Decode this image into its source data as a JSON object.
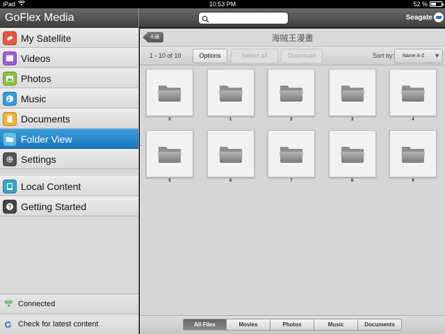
{
  "status_bar": {
    "device": "iPad",
    "time": "10:53 PM",
    "battery_text": "52 %",
    "battery_level": 0.52
  },
  "app": {
    "title": "GoFlex Media"
  },
  "sidebar": {
    "items": [
      {
        "label": "My Satellite",
        "icon": "satellite-icon",
        "color": "#e55a3e"
      },
      {
        "label": "Videos",
        "icon": "film-icon",
        "color": "#9b5fd6"
      },
      {
        "label": "Photos",
        "icon": "photo-icon",
        "color": "#8cc43b"
      },
      {
        "label": "Music",
        "icon": "music-icon",
        "color": "#2f9fe0"
      },
      {
        "label": "Documents",
        "icon": "document-icon",
        "color": "#f2b233"
      },
      {
        "label": "Folder View",
        "icon": "folder-icon",
        "color": "#5cc0e8",
        "selected": true
      },
      {
        "label": "Settings",
        "icon": "gear-icon",
        "color": "#555555"
      }
    ],
    "secondary_items": [
      {
        "label": "Local Content",
        "icon": "device-icon",
        "color": "#3aa4c8"
      },
      {
        "label": "Getting Started",
        "icon": "help-icon",
        "color": "#444444"
      }
    ],
    "footer": {
      "connected_label": "Connected",
      "refresh_label": "Check for latest content"
    }
  },
  "header": {
    "search_placeholder": "",
    "logo_text": "Seagate"
  },
  "folder": {
    "back_label": "卡通",
    "title": "海贼王漫畫",
    "count_label": "1 - 10 of 10",
    "options_label": "Options",
    "select_all_label": "Select all",
    "download_label": "Download",
    "sort_label": "Sort by:",
    "sort_value": "Name A-Z",
    "items": [
      "0",
      "1",
      "2",
      "3",
      "4",
      "5",
      "6",
      "7",
      "8",
      "9"
    ]
  },
  "tabs": {
    "items": [
      {
        "label": "All Files",
        "active": true
      },
      {
        "label": "Movies"
      },
      {
        "label": "Photos"
      },
      {
        "label": "Music"
      },
      {
        "label": "Documents"
      }
    ]
  },
  "colors": {
    "selected_blue": "#1c78bf",
    "toolbar_dark": "#3e3e3e"
  }
}
